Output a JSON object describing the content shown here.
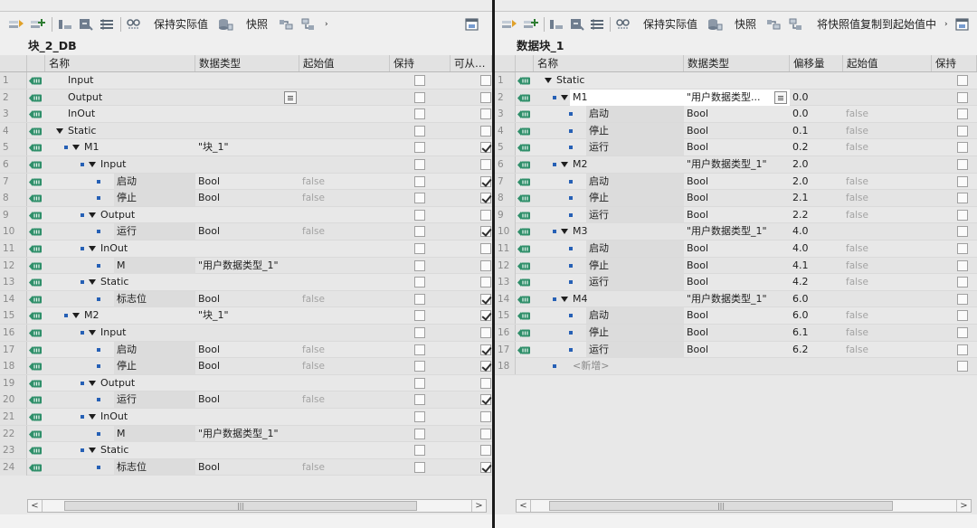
{
  "left": {
    "toolbar": {
      "keep_actual": "保持实际值",
      "snapshot": "快照",
      "overflow": "›"
    },
    "block_title": "块_2_DB",
    "headers": [
      "名称",
      "数据类型",
      "起始值",
      "保持",
      "可从…"
    ],
    "rows": [
      {
        "n": "1",
        "lvl": 0,
        "sq": false,
        "tri": false,
        "name": "Input",
        "type": "",
        "start": "",
        "keep": false,
        "acc": false
      },
      {
        "n": "2",
        "lvl": 0,
        "sq": false,
        "tri": false,
        "name": "Output",
        "type": "",
        "start": "",
        "keep": false,
        "acc": false,
        "drop": true
      },
      {
        "n": "3",
        "lvl": 0,
        "sq": false,
        "tri": false,
        "name": "InOut",
        "type": "",
        "start": "",
        "keep": false,
        "acc": false
      },
      {
        "n": "4",
        "lvl": 0,
        "sq": false,
        "tri": true,
        "name": "Static",
        "type": "",
        "start": "",
        "keep": false,
        "acc": false
      },
      {
        "n": "5",
        "lvl": 1,
        "sq": true,
        "tri": true,
        "name": "M1",
        "type": "\"块_1\"",
        "start": "",
        "keep": false,
        "acc": true
      },
      {
        "n": "6",
        "lvl": 2,
        "sq": true,
        "tri": true,
        "name": "Input",
        "type": "",
        "start": "",
        "keep": false,
        "acc": false
      },
      {
        "n": "7",
        "lvl": 3,
        "sq": true,
        "tri": false,
        "name": "启动",
        "type": "Bool",
        "start": "false",
        "keep": false,
        "acc": true
      },
      {
        "n": "8",
        "lvl": 3,
        "sq": true,
        "tri": false,
        "name": "停止",
        "type": "Bool",
        "start": "false",
        "keep": false,
        "acc": true
      },
      {
        "n": "9",
        "lvl": 2,
        "sq": true,
        "tri": true,
        "name": "Output",
        "type": "",
        "start": "",
        "keep": false,
        "acc": false
      },
      {
        "n": "10",
        "lvl": 3,
        "sq": true,
        "tri": false,
        "name": "运行",
        "type": "Bool",
        "start": "false",
        "keep": false,
        "acc": true
      },
      {
        "n": "11",
        "lvl": 2,
        "sq": true,
        "tri": true,
        "name": "InOut",
        "type": "",
        "start": "",
        "keep": false,
        "acc": false
      },
      {
        "n": "12",
        "lvl": 3,
        "sq": true,
        "tri": false,
        "name": "M",
        "type": "\"用户数据类型_1\"",
        "start": "",
        "keep": false,
        "acc": false
      },
      {
        "n": "13",
        "lvl": 2,
        "sq": true,
        "tri": true,
        "name": "Static",
        "type": "",
        "start": "",
        "keep": false,
        "acc": false
      },
      {
        "n": "14",
        "lvl": 3,
        "sq": true,
        "tri": false,
        "name": "标志位",
        "type": "Bool",
        "start": "false",
        "keep": false,
        "acc": true
      },
      {
        "n": "15",
        "lvl": 1,
        "sq": true,
        "tri": true,
        "name": "M2",
        "type": "\"块_1\"",
        "start": "",
        "keep": false,
        "acc": true
      },
      {
        "n": "16",
        "lvl": 2,
        "sq": true,
        "tri": true,
        "name": "Input",
        "type": "",
        "start": "",
        "keep": false,
        "acc": false
      },
      {
        "n": "17",
        "lvl": 3,
        "sq": true,
        "tri": false,
        "name": "启动",
        "type": "Bool",
        "start": "false",
        "keep": false,
        "acc": true
      },
      {
        "n": "18",
        "lvl": 3,
        "sq": true,
        "tri": false,
        "name": "停止",
        "type": "Bool",
        "start": "false",
        "keep": false,
        "acc": true
      },
      {
        "n": "19",
        "lvl": 2,
        "sq": true,
        "tri": true,
        "name": "Output",
        "type": "",
        "start": "",
        "keep": false,
        "acc": false
      },
      {
        "n": "20",
        "lvl": 3,
        "sq": true,
        "tri": false,
        "name": "运行",
        "type": "Bool",
        "start": "false",
        "keep": false,
        "acc": true
      },
      {
        "n": "21",
        "lvl": 2,
        "sq": true,
        "tri": true,
        "name": "InOut",
        "type": "",
        "start": "",
        "keep": false,
        "acc": false
      },
      {
        "n": "22",
        "lvl": 3,
        "sq": true,
        "tri": false,
        "name": "M",
        "type": "\"用户数据类型_1\"",
        "start": "",
        "keep": false,
        "acc": false
      },
      {
        "n": "23",
        "lvl": 2,
        "sq": true,
        "tri": true,
        "name": "Static",
        "type": "",
        "start": "",
        "keep": false,
        "acc": false
      },
      {
        "n": "24",
        "lvl": 3,
        "sq": true,
        "tri": false,
        "name": "标志位",
        "type": "Bool",
        "start": "false",
        "keep": false,
        "acc": true
      }
    ],
    "scroll": {
      "left": "<",
      "right": ">",
      "thumb": "|||"
    }
  },
  "right": {
    "toolbar": {
      "keep_actual": "保持实际值",
      "snapshot": "快照",
      "copy_snapshot": "将快照值复制到起始值中",
      "overflow": "›"
    },
    "block_title": "数据块_1",
    "headers": [
      "名称",
      "数据类型",
      "偏移量",
      "起始值",
      "保持"
    ],
    "rows": [
      {
        "n": "1",
        "lvl": 0,
        "sq": false,
        "tri": true,
        "name": "Static",
        "type": "",
        "offset": "",
        "start": "",
        "keep": false
      },
      {
        "n": "2",
        "lvl": 1,
        "sq": true,
        "tri": true,
        "name": "M1",
        "type": "\"用户数据类型...",
        "offset": "0.0",
        "start": "",
        "keep": false,
        "drop": true,
        "selected": true
      },
      {
        "n": "3",
        "lvl": 2,
        "sq": true,
        "tri": false,
        "name": "启动",
        "type": "Bool",
        "offset": "0.0",
        "start": "false",
        "keep": false
      },
      {
        "n": "4",
        "lvl": 2,
        "sq": true,
        "tri": false,
        "name": "停止",
        "type": "Bool",
        "offset": "0.1",
        "start": "false",
        "keep": false
      },
      {
        "n": "5",
        "lvl": 2,
        "sq": true,
        "tri": false,
        "name": "运行",
        "type": "Bool",
        "offset": "0.2",
        "start": "false",
        "keep": false
      },
      {
        "n": "6",
        "lvl": 1,
        "sq": true,
        "tri": true,
        "name": "M2",
        "type": "\"用户数据类型_1\"",
        "offset": "2.0",
        "start": "",
        "keep": false
      },
      {
        "n": "7",
        "lvl": 2,
        "sq": true,
        "tri": false,
        "name": "启动",
        "type": "Bool",
        "offset": "2.0",
        "start": "false",
        "keep": false
      },
      {
        "n": "8",
        "lvl": 2,
        "sq": true,
        "tri": false,
        "name": "停止",
        "type": "Bool",
        "offset": "2.1",
        "start": "false",
        "keep": false
      },
      {
        "n": "9",
        "lvl": 2,
        "sq": true,
        "tri": false,
        "name": "运行",
        "type": "Bool",
        "offset": "2.2",
        "start": "false",
        "keep": false
      },
      {
        "n": "10",
        "lvl": 1,
        "sq": true,
        "tri": true,
        "name": "M3",
        "type": "\"用户数据类型_1\"",
        "offset": "4.0",
        "start": "",
        "keep": false
      },
      {
        "n": "11",
        "lvl": 2,
        "sq": true,
        "tri": false,
        "name": "启动",
        "type": "Bool",
        "offset": "4.0",
        "start": "false",
        "keep": false
      },
      {
        "n": "12",
        "lvl": 2,
        "sq": true,
        "tri": false,
        "name": "停止",
        "type": "Bool",
        "offset": "4.1",
        "start": "false",
        "keep": false
      },
      {
        "n": "13",
        "lvl": 2,
        "sq": true,
        "tri": false,
        "name": "运行",
        "type": "Bool",
        "offset": "4.2",
        "start": "false",
        "keep": false
      },
      {
        "n": "14",
        "lvl": 1,
        "sq": true,
        "tri": true,
        "name": "M4",
        "type": "\"用户数据类型_1\"",
        "offset": "6.0",
        "start": "",
        "keep": false
      },
      {
        "n": "15",
        "lvl": 2,
        "sq": true,
        "tri": false,
        "name": "启动",
        "type": "Bool",
        "offset": "6.0",
        "start": "false",
        "keep": false
      },
      {
        "n": "16",
        "lvl": 2,
        "sq": true,
        "tri": false,
        "name": "停止",
        "type": "Bool",
        "offset": "6.1",
        "start": "false",
        "keep": false
      },
      {
        "n": "17",
        "lvl": 2,
        "sq": true,
        "tri": false,
        "name": "运行",
        "type": "Bool",
        "offset": "6.2",
        "start": "false",
        "keep": false
      },
      {
        "n": "18",
        "lvl": 1,
        "sq": true,
        "tri": false,
        "name": "<新增>",
        "type": "",
        "offset": "",
        "start": "",
        "keep": false,
        "placeholder": true,
        "noicon": true
      }
    ],
    "scroll": {
      "left": "<",
      "right": ">",
      "thumb": "|||"
    }
  },
  "colors": {
    "accent": "#2660b5",
    "icon_green": "#2f8f6a",
    "row_band": "#d5d5d5",
    "header": "#e2e2e2"
  }
}
